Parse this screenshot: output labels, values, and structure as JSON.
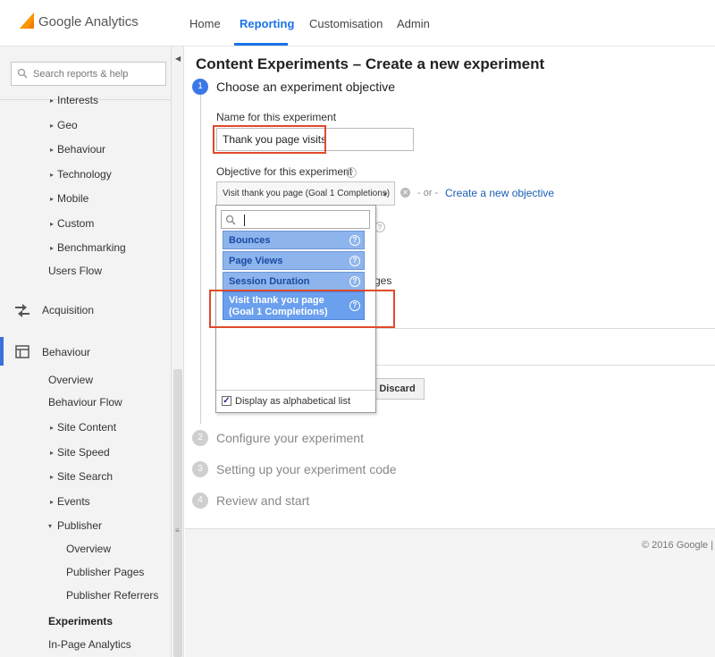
{
  "header": {
    "brand": "Google Analytics",
    "nav": [
      {
        "label": "Home"
      },
      {
        "label": "Reporting"
      },
      {
        "label": "Customisation"
      },
      {
        "label": "Admin"
      }
    ],
    "active_nav": "Reporting",
    "accent_color": "#1a73e8"
  },
  "sidebar": {
    "search_placeholder": "Search reports & help",
    "items": [
      {
        "label": "Interests"
      },
      {
        "label": "Geo"
      },
      {
        "label": "Behaviour"
      },
      {
        "label": "Technology"
      },
      {
        "label": "Mobile"
      },
      {
        "label": "Custom"
      },
      {
        "label": "Benchmarking"
      },
      {
        "label": "Users Flow"
      }
    ],
    "sections": {
      "acquisition": "Acquisition",
      "behaviour": "Behaviour"
    },
    "behaviour_items": [
      {
        "label": "Overview"
      },
      {
        "label": "Behaviour Flow"
      },
      {
        "label": "Site Content"
      },
      {
        "label": "Site Speed"
      },
      {
        "label": "Site Search"
      },
      {
        "label": "Events"
      },
      {
        "label": "Publisher"
      }
    ],
    "publisher_items": [
      {
        "label": "Overview"
      },
      {
        "label": "Publisher Pages"
      },
      {
        "label": "Publisher Referrers"
      }
    ],
    "experiments": "Experiments",
    "in_page": "In-Page Analytics"
  },
  "main": {
    "title": "Content Experiments – Create a new experiment",
    "steps": [
      {
        "number": "1",
        "title": "Choose an experiment objective"
      },
      {
        "number": "2",
        "title": "Configure your experiment"
      },
      {
        "number": "3",
        "title": "Setting up your experiment code"
      },
      {
        "number": "4",
        "title": "Review and start"
      }
    ],
    "name_label": "Name for this experiment",
    "name_value": "Thank you page visits",
    "objective_label": "Objective for this experiment",
    "objective_value": "Visit thank you page (Goal 1 Completions)",
    "or_text": "- or -",
    "create_link": "Create a new objective",
    "behind_text": "ges",
    "discard_label": "Discard"
  },
  "dropdown": {
    "search_value": "",
    "options": [
      {
        "label": "Bounces"
      },
      {
        "label": "Page Views"
      },
      {
        "label": "Session Duration"
      },
      {
        "label": "Visit thank you page (Goal 1 Completions)"
      }
    ],
    "alphabetical_label": "Display as alphabetical list",
    "alphabetical_checked": true
  },
  "footer": {
    "copyright": "© 2016 Google |"
  },
  "icons": [
    "analytics-logo-icon",
    "search-icon",
    "acquisition-icon",
    "behaviour-icon",
    "help-icon",
    "clear-icon",
    "checkbox-icon"
  ]
}
